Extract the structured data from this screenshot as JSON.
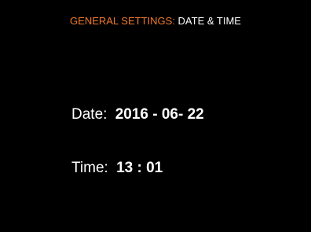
{
  "header": {
    "section": "GENERAL SETTINGS:",
    "page": "DATE & TIME"
  },
  "date": {
    "label": "Date:",
    "value": "2016 - 06- 22"
  },
  "time": {
    "label": "Time:",
    "value": "13 : 01"
  },
  "colors": {
    "background": "#000000",
    "accent": "#f07a2d",
    "text": "#ffffff"
  }
}
